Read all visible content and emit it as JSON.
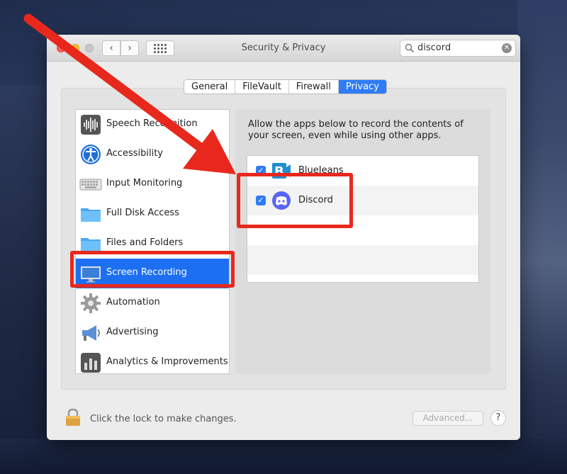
{
  "window": {
    "title": "Security & Privacy"
  },
  "search": {
    "value": "discord"
  },
  "tabs": [
    {
      "label": "General",
      "active": false
    },
    {
      "label": "FileVault",
      "active": false
    },
    {
      "label": "Firewall",
      "active": false
    },
    {
      "label": "Privacy",
      "active": true
    }
  ],
  "sidebar": {
    "items": [
      {
        "label": "Speech Recognition",
        "icon": "waveform-icon",
        "selected": false
      },
      {
        "label": "Accessibility",
        "icon": "accessibility-icon",
        "selected": false
      },
      {
        "label": "Input Monitoring",
        "icon": "keyboard-icon",
        "selected": false
      },
      {
        "label": "Full Disk Access",
        "icon": "folder-icon",
        "selected": false
      },
      {
        "label": "Files and Folders",
        "icon": "folder-icon",
        "selected": false
      },
      {
        "label": "Screen Recording",
        "icon": "display-icon",
        "selected": true
      },
      {
        "label": "Automation",
        "icon": "gear-icon",
        "selected": false
      },
      {
        "label": "Advertising",
        "icon": "megaphone-icon",
        "selected": false
      },
      {
        "label": "Analytics & Improvements",
        "icon": "bar-chart-icon",
        "selected": false
      }
    ]
  },
  "main": {
    "description": "Allow the apps below to record the contents of your screen, even while using other apps.",
    "apps": [
      {
        "name": "BlueJeans",
        "checked": true,
        "icon": "bluejeans-icon"
      },
      {
        "name": "Discord",
        "checked": true,
        "icon": "discord-icon"
      }
    ]
  },
  "footer": {
    "lock_text": "Click the lock to make changes.",
    "advanced_label": "Advanced...",
    "help_label": "?"
  },
  "colors": {
    "accent": "#2f7cf6",
    "selection": "#1d6ff2",
    "annotation": "#e8281c"
  }
}
